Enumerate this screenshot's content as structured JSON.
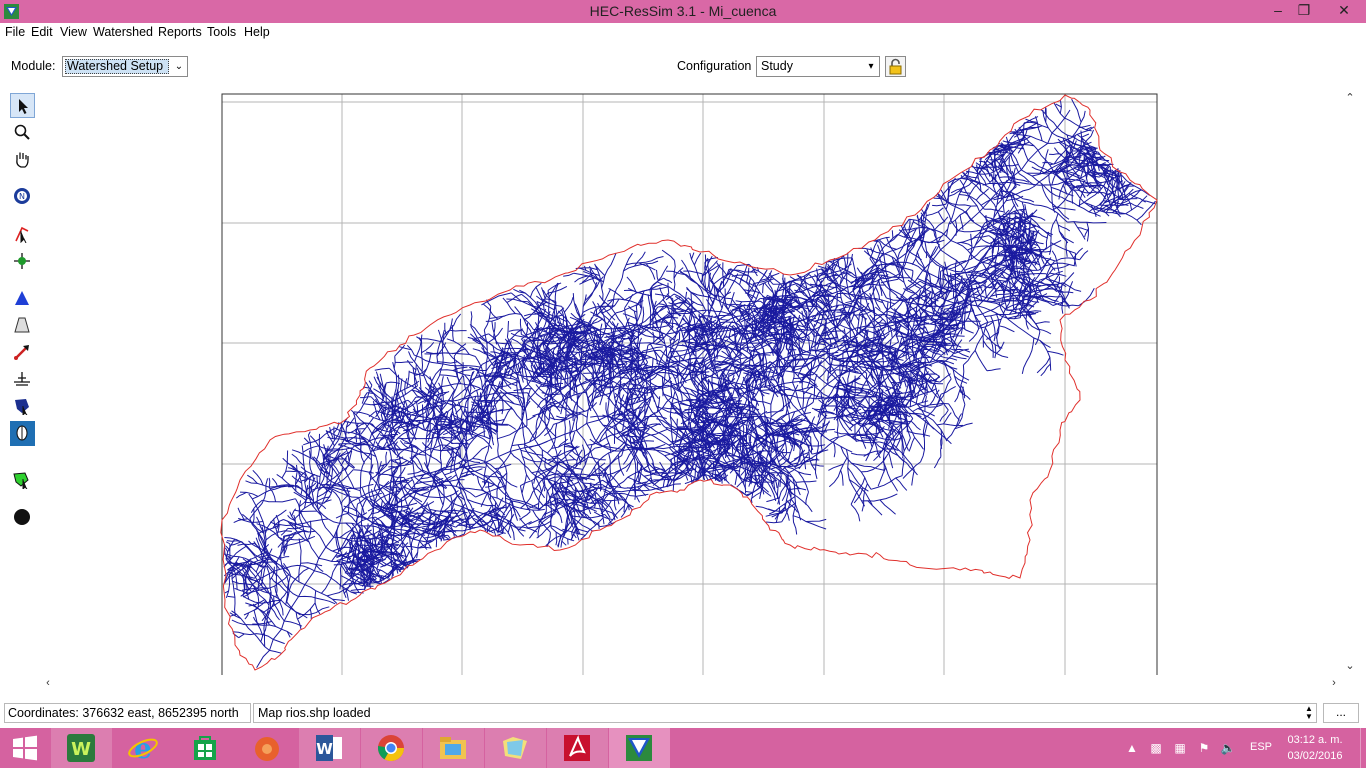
{
  "window": {
    "title": "HEC-ResSim 3.1  - Mi_cuenca",
    "minimize": "–",
    "restore": "❐",
    "close": "✕"
  },
  "menu": [
    "File",
    "Edit",
    "View",
    "Watershed",
    "Reports",
    "Tools",
    "Help"
  ],
  "module": {
    "label": "Module:",
    "value": "Watershed Setup"
  },
  "configuration": {
    "label": "Configuration",
    "value": "Study"
  },
  "toolbar_tools": [
    "select-tool-icon",
    "zoom-tool-icon",
    "pan-tool-icon",
    "network-tool-icon",
    "stream-alignment-tool-icon",
    "junction-tool-icon",
    "reservoir-tool-icon",
    "diversion-tool-icon",
    "reach-tool-icon",
    "computation-point-tool-icon",
    "impact-area-tool-icon",
    "reservoir-node-tool-icon",
    "basin-tool-icon",
    "point-tool-icon"
  ],
  "map": {
    "layer": "rios.shp",
    "boundary_color": "#e0302c",
    "river_color": "#1a1aa0",
    "grid_color": "#b4b4b4"
  },
  "status": {
    "coordinates": "Coordinates: 376632 east, 8652395 north",
    "message": "Map rios.shp loaded",
    "more": "..."
  },
  "taskbar": {
    "apps": [
      "start-button",
      "wamp-icon",
      "internet-explorer-icon",
      "store-icon",
      "firefox-icon",
      "word-icon",
      "chrome-icon",
      "file-explorer-icon",
      "folder-icon",
      "acrobat-icon",
      "ressim-icon"
    ],
    "language": "ESP",
    "time": "03:12 a. m.",
    "date": "03/02/2016"
  }
}
